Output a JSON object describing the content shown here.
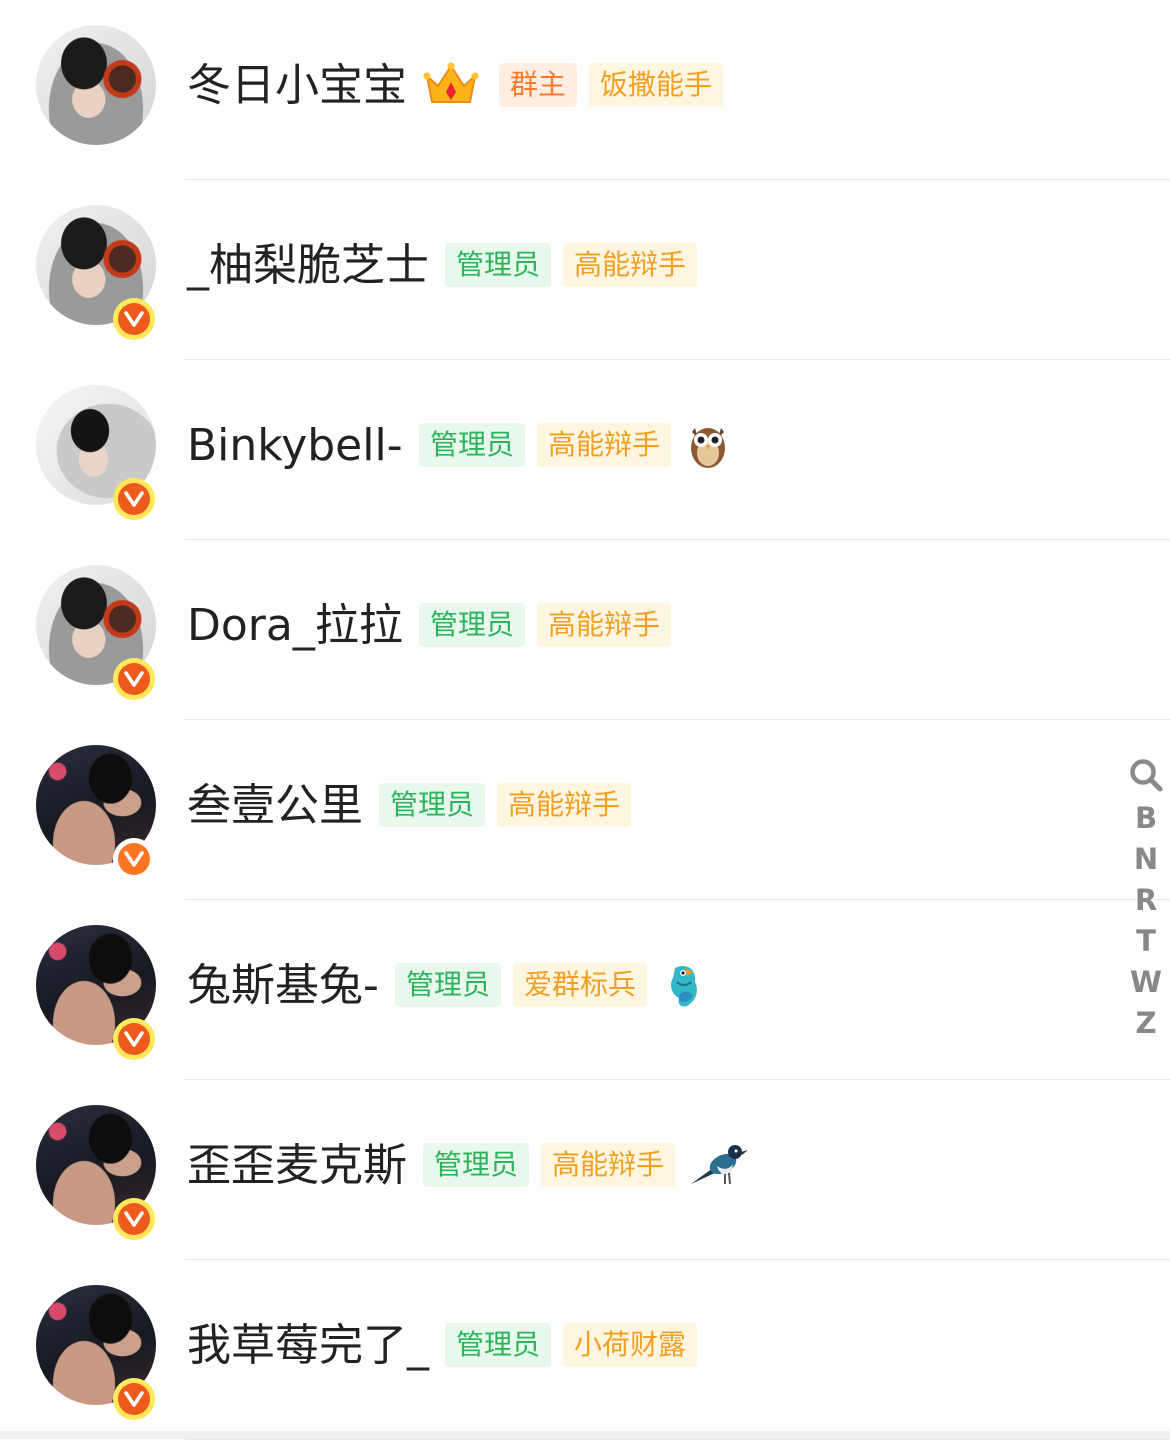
{
  "members": [
    {
      "name": "冬日小宝宝",
      "avatar": "avatar-headphone-hood",
      "badge": null,
      "title_icon": "crown-icon",
      "tags": [
        {
          "label": "群主",
          "style": "owner"
        },
        {
          "label": "饭撒能手",
          "style": "orange"
        }
      ],
      "emoji": null
    },
    {
      "name": "_柚梨脆芝士",
      "avatar": "avatar-headphone-hood",
      "badge": "v-badge",
      "title_icon": null,
      "tags": [
        {
          "label": "管理员",
          "style": "green"
        },
        {
          "label": "高能辩手",
          "style": "orange"
        }
      ],
      "emoji": null
    },
    {
      "name": "Binkybell-",
      "avatar": "avatar-white-hood",
      "badge": "v-badge",
      "title_icon": null,
      "tags": [
        {
          "label": "管理员",
          "style": "green"
        },
        {
          "label": "高能辩手",
          "style": "orange"
        }
      ],
      "emoji": "owl-icon"
    },
    {
      "name": "Dora_拉拉",
      "avatar": "avatar-headphone-hood",
      "badge": "v-badge",
      "title_icon": null,
      "tags": [
        {
          "label": "管理员",
          "style": "green"
        },
        {
          "label": "高能辩手",
          "style": "orange"
        }
      ],
      "emoji": null
    },
    {
      "name": "叁壹公里",
      "avatar": "avatar-dark-room",
      "badge": "v-badge-white",
      "title_icon": null,
      "tags": [
        {
          "label": "管理员",
          "style": "green"
        },
        {
          "label": "高能辩手",
          "style": "orange"
        }
      ],
      "emoji": null
    },
    {
      "name": "兔斯基兔-",
      "avatar": "avatar-dark-room",
      "badge": "v-badge",
      "title_icon": null,
      "tags": [
        {
          "label": "管理员",
          "style": "green"
        },
        {
          "label": "爱群标兵",
          "style": "orange"
        }
      ],
      "emoji": "parrot-icon"
    },
    {
      "name": "歪歪麦克斯",
      "avatar": "avatar-dark-room",
      "badge": "v-badge",
      "title_icon": null,
      "tags": [
        {
          "label": "管理员",
          "style": "green"
        },
        {
          "label": "高能辩手",
          "style": "orange"
        }
      ],
      "emoji": "magpie-icon"
    },
    {
      "name": "我草莓完了_",
      "avatar": "avatar-dark-room",
      "badge": "v-badge",
      "title_icon": null,
      "tags": [
        {
          "label": "管理员",
          "style": "green"
        },
        {
          "label": "小荷财露",
          "style": "orange"
        }
      ],
      "emoji": null
    }
  ],
  "index_bar": {
    "search_icon": "search-icon",
    "letters": [
      "B",
      "N",
      "R",
      "T",
      "W",
      "Z"
    ]
  },
  "colors": {
    "tag_green_text": "#2cb45a",
    "tag_green_bg": "#e8f8ec",
    "tag_orange_text": "#f2a021",
    "tag_orange_bg": "#fff6e2",
    "tag_owner_text": "#ff7a2a",
    "tag_owner_bg": "#ffefe3",
    "badge_orange": "#ee5a1c",
    "badge_yellow_ring": "#ffe95a"
  }
}
